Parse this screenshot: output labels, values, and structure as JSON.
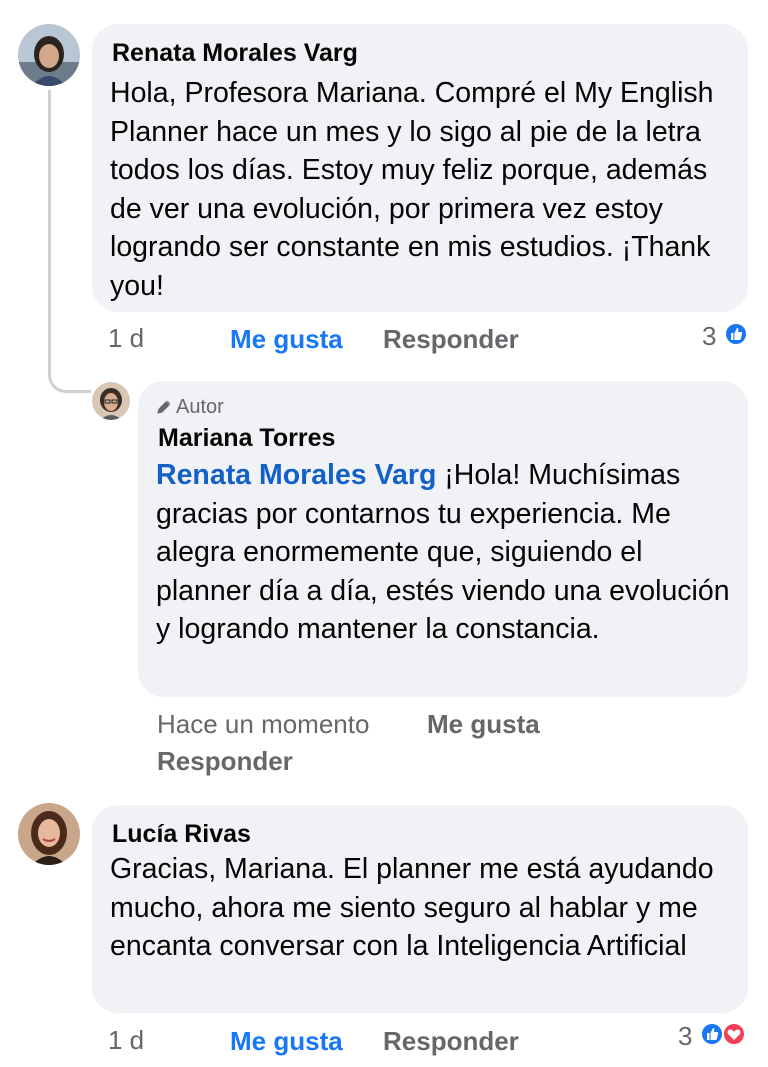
{
  "comments": [
    {
      "author": "Renata Morales Varg",
      "text": "Hola, Profesora Mariana. Compré el My English Planner hace un mes y lo sigo al pie de la letra todos los días. Estoy muy feliz porque, además de ver una evolución, por primera vez estoy logrando ser constante en mis estudios. ¡Thank you!",
      "time": "1 d",
      "like_label": "Me gusta",
      "reply_label": "Responder",
      "reaction_count": "3",
      "reactions": [
        "like-icon"
      ]
    },
    {
      "badge_icon": "pencil-icon",
      "badge": "Autor",
      "author": "Mariana Torres",
      "mention": "Renata Morales Varg",
      "text": " ¡Hola! Muchísimas gracias por contarnos tu experiencia. Me alegra enormemente que, siguiendo el planner día a día, estés viendo una evolución y logrando mantener la constancia.",
      "time": "Hace un momento",
      "like_label": "Me gusta",
      "reply_label": "Responder"
    },
    {
      "author": "Lucía Rivas",
      "text": "Gracias, Mariana. El planner me está ayudando mucho, ahora me siento seguro al hablar y me encanta conversar con la Inteligencia Artificial",
      "time": "1 d",
      "like_label": "Me gusta",
      "reply_label": "Responder",
      "reaction_count": "3",
      "reactions": [
        "like-icon",
        "love-icon"
      ]
    }
  ],
  "colors": {
    "bubble": "#f0f2f5",
    "link": "#1877f2",
    "mention": "#1360c7",
    "meta": "#65676b",
    "love": "#f33e58"
  }
}
